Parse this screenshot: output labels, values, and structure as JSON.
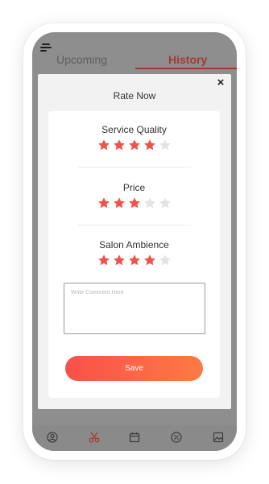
{
  "header": {
    "menu_icon": "hamburger-icon",
    "tabs": [
      {
        "label": "Upcoming",
        "active": false
      },
      {
        "label": "History",
        "active": true
      }
    ]
  },
  "modal": {
    "title": "Rate Now",
    "close_label": "×",
    "ratings": [
      {
        "label": "Service Quality",
        "value": 4,
        "max": 5
      },
      {
        "label": "Price",
        "value": 3,
        "max": 5
      },
      {
        "label": "Salon Ambience",
        "value": 4,
        "max": 5
      }
    ],
    "comment": {
      "value": "",
      "placeholder": "Write Comment Here"
    },
    "save_label": "Save"
  },
  "bottom_nav": [
    {
      "icon": "profile-icon"
    },
    {
      "icon": "scissors-icon",
      "active": true
    },
    {
      "icon": "calendar-icon"
    },
    {
      "icon": "discount-icon"
    },
    {
      "icon": "gallery-icon"
    }
  ],
  "colors": {
    "star_filled": "#f1524b",
    "star_empty": "#e3e3e3",
    "accent": "#f9504a",
    "accent_end": "#fd7a45",
    "tab_active": "#a33a32",
    "overlay": "#8e8e8e"
  }
}
